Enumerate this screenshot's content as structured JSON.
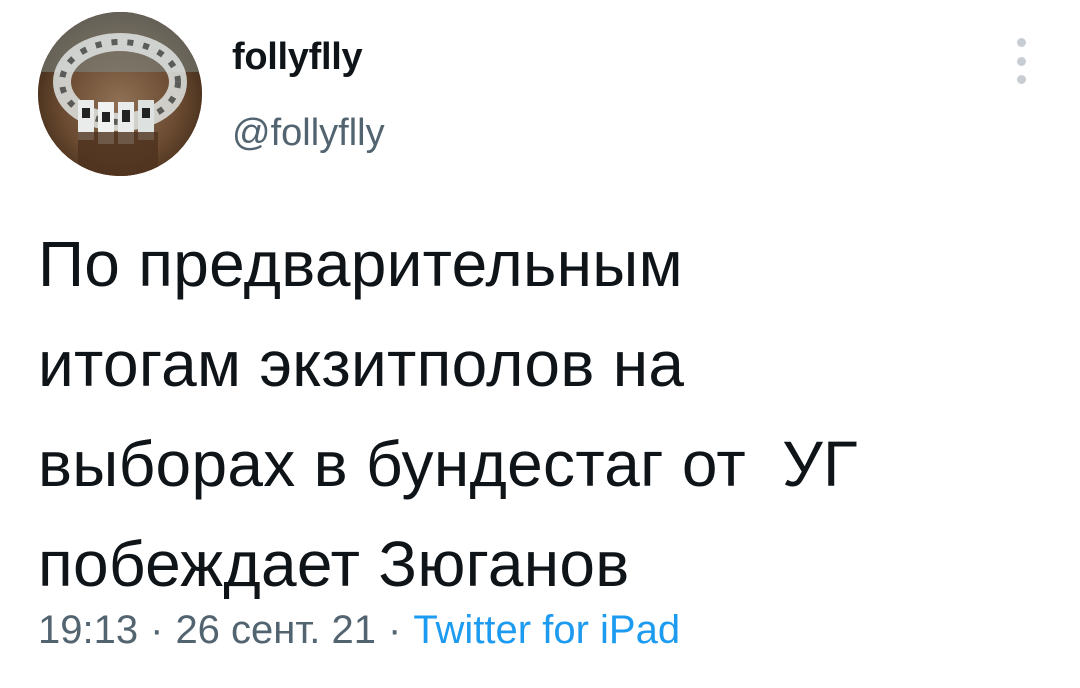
{
  "author": {
    "display_name": "follyflly",
    "handle": "@follyflly"
  },
  "tweet": {
    "text": "По предварительным\nитогам экзитполов на\nвыборах в бундестаг от  УГ\nпобеждает Зюганов",
    "time": "19:13",
    "date": "26 сент. 21",
    "separator": "·",
    "source": "Twitter for iPad"
  },
  "icons": {
    "more": "more-vertical-icon"
  },
  "colors": {
    "text": "#0f1419",
    "secondary": "#536471",
    "link": "#1d9bf0"
  }
}
